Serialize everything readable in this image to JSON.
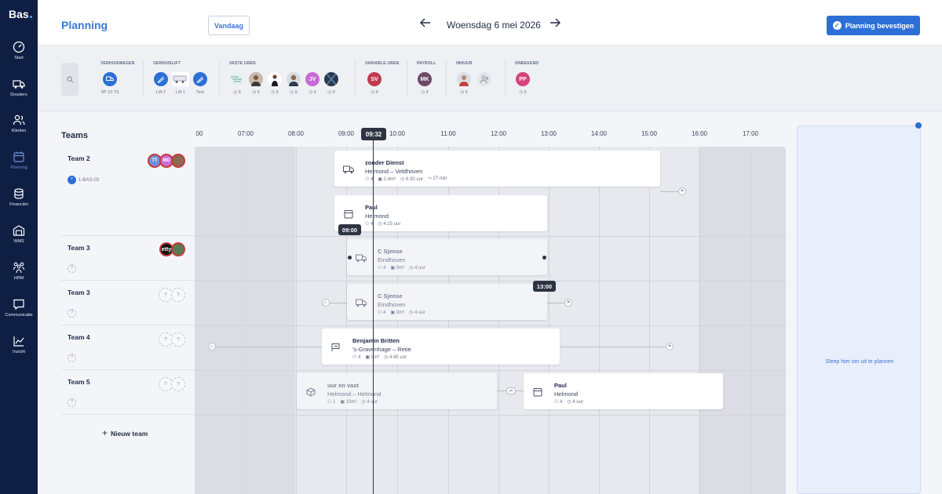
{
  "app": {
    "logo": "Bas"
  },
  "sidebar": {
    "items": [
      {
        "label": "Start",
        "icon": "dashboard-icon"
      },
      {
        "label": "Dossiers",
        "icon": "truck-icon"
      },
      {
        "label": "Klanten",
        "icon": "users-icon"
      },
      {
        "label": "Planning",
        "icon": "calendar-icon",
        "active": true
      },
      {
        "label": "Financiën",
        "icon": "coins-icon"
      },
      {
        "label": "WMS",
        "icon": "warehouse-icon"
      },
      {
        "label": "HRM",
        "icon": "people-icon"
      },
      {
        "label": "Communicatie",
        "icon": "chat-icon"
      },
      {
        "label": "Inzicht",
        "icon": "chart-icon"
      }
    ]
  },
  "header": {
    "title": "Planning",
    "today_label": "Vandaag",
    "date": "Woensdag 6 mei 2026",
    "confirm_label": "Planning bevestigen"
  },
  "resources": {
    "groups": [
      {
        "title": "VERHUISWAGEN",
        "items": [
          {
            "label": "XP 10 TS"
          }
        ]
      },
      {
        "title": "VERHUISLIFT",
        "items": [
          {
            "label": "Lift 2"
          },
          {
            "label": "Lift 1"
          },
          {
            "label": "Test"
          }
        ]
      },
      {
        "title": "VASTE UREN",
        "items": [
          {
            "label": "9"
          },
          {
            "label": "9"
          },
          {
            "label": "9"
          },
          {
            "label": "9"
          },
          {
            "initials": "JV",
            "label": "9"
          },
          {
            "label": "9"
          }
        ]
      },
      {
        "title": "VARIABLE UREN",
        "items": [
          {
            "initials": "SV",
            "label": "9"
          }
        ]
      },
      {
        "title": "PAYROLL",
        "items": [
          {
            "initials": "MK",
            "label": "9"
          }
        ]
      },
      {
        "title": "INHUUR",
        "items": [
          {
            "label": "9"
          }
        ]
      },
      {
        "title": "ONBEKEND",
        "items": [
          {
            "initials": "PP",
            "label": "9"
          }
        ]
      }
    ]
  },
  "teams": {
    "heading": "Teams",
    "rows": [
      {
        "name": "Team 2",
        "vehicle": "1-BAS-03",
        "avatars": [
          "TT",
          "MD",
          ""
        ]
      },
      {
        "name": "Team 3",
        "vehicle": "?",
        "avatars": [
          "etty",
          ""
        ]
      },
      {
        "name": "Team 3",
        "vehicle": "?",
        "avatars": [
          "?",
          "?"
        ]
      },
      {
        "name": "Team 4",
        "vehicle": "?",
        "avatars": [
          "?",
          "?"
        ]
      },
      {
        "name": "Team 5",
        "vehicle": "?",
        "avatars": [
          "?",
          "?"
        ]
      }
    ],
    "new_team_label": "Nieuw team"
  },
  "timeline": {
    "hours": [
      "00",
      "07:00",
      "08:00",
      "09:00",
      "10:00",
      "11:00",
      "12:00",
      "13:00",
      "14:00",
      "15:00",
      "16:00",
      "17:00"
    ],
    "now": "09:32",
    "drag_start": "09:00",
    "drag_end": "13:00"
  },
  "jobs": [
    {
      "title": "zonder Dienst",
      "route": "Helmond – Veldhoven",
      "persons": "4",
      "volume": "2.4m³",
      "duration": "6:30 uur",
      "travel": "27 min"
    },
    {
      "title": "Paul",
      "route": "Helmond",
      "persons": "4",
      "duration": "4:15 uur"
    },
    {
      "title": "C Sjense",
      "route": "Eindhoven",
      "persons": "4",
      "volume": "0m³",
      "duration": "4 uur"
    },
    {
      "title": "C Sjense",
      "route": "Eindhoven",
      "persons": "4",
      "volume": "0m³",
      "duration": "4 uur"
    },
    {
      "title": "Benjamin Britten",
      "route": "'s-Gravenhage – Retie",
      "persons": "4",
      "volume": "0m³",
      "duration": "4:45 uur"
    },
    {
      "title": "uur en vast",
      "route": "Helmond – Helmond",
      "persons": "1",
      "volume": "10m³",
      "duration": "4 uur"
    },
    {
      "title": "Paul",
      "route": "Helmond",
      "persons": "4",
      "duration": "4 uur"
    }
  ],
  "dropzone": {
    "label": "Sleep hier om uit te plannen"
  },
  "colors": {
    "accent": "#2c6fd6",
    "sidebar": "#0f1f44",
    "now": "#2f3442"
  }
}
